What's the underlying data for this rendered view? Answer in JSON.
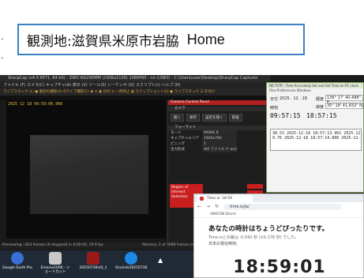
{
  "caption": {
    "location": "観測地:滋賀県米原市岩脇",
    "home": "Home",
    "border_color": "#3b82c4"
  },
  "sharpcap": {
    "title": "SharpCap (v4.0.9571, 64 bit) - ZWO ASI290MM (1936x1100) 1080P60 - no (USB3) - C:\\Users\\user\\Desktop\\SharpCap Captures",
    "menu": "ファイル (F)  カメラ(C)  キャプチャ(A)  表示 (V)  ツール(S)  シーケンサ (Q)  スクリプト(r)  ヘルプ (H)",
    "toolbar": "ライブスタック (L)  ● 最初の撮影(A)  ⏱ライブ撮影(C)  ◉ ⊙  ▣ 日付  ⊘ 一時停止  ▦ スナップショット(S)  ● ライブスタック  ☰ 外付け",
    "frame_text": "2025 12 18 09:59:00.066",
    "panel_title": "Camera Control Panel",
    "panel_section_1": "カメラ",
    "panel_buttons": [
      "開く",
      "保存",
      "設定を開く",
      "管理"
    ],
    "panel_section_2": "フォーマット",
    "rows": [
      {
        "label": "モード",
        "value": "MONO 8"
      },
      {
        "label": "キャプチャエリア",
        "value": "1920x700"
      },
      {
        "label": "ビニング",
        "value": "1"
      },
      {
        "label": "出力形式",
        "value": "AVI ファイル (*.avi)"
      }
    ],
    "roi_label": "Region of Interest Selection",
    "status_left": "Previewing : 823 frames (6 dropped) in 0:00:40, 19.9 fps",
    "status_right": "Memory: 2 of 3998 frames in use"
  },
  "taskbar": {
    "items": [
      {
        "label": "Google Earth Pro",
        "color": "#3a6fd8"
      },
      {
        "label": "Emovie1006 - ショートカット",
        "color": "#c9c9c9"
      },
      {
        "label": "20250730st4_1",
        "color": "#9a1a1a"
      },
      {
        "label": "Ocoindr20250730",
        "color": "#1e88e5"
      }
    ]
  },
  "timesync": {
    "title": "NICTSTP - Time Accurately Set and Set Time on PC clock",
    "menu": "Files  Preferences  Windows",
    "date_label": "日付",
    "date": "2025 . 12 . 18",
    "lon_label": "経度",
    "longitude": "136° 17' 40.488\" E",
    "lat_label": "緯度",
    "latitude": "35° 18' 41.832\" N",
    "time_label": "時刻",
    "time": "09:57:15",
    "time2": "18:57:15",
    "list_line_1": "38.53  2025-12-18 18:57:13.961  2025-12-18",
    "list_line_2": "9.76   2025-12-18 18:57:14.890  2025-12-18 1"
  },
  "browser": {
    "tab_title": "Time.is: 18:59",
    "url": "time.is/ja/",
    "bookmarks": "UNICON Drivrs",
    "heading": "あなたの時計はちょうどぴったりです。",
    "sub1": "Time.isとの差は -0.042 秒 (±0.176 秒) でした。",
    "sub2": "日本の現在時刻:",
    "clock": "18:59:01"
  }
}
